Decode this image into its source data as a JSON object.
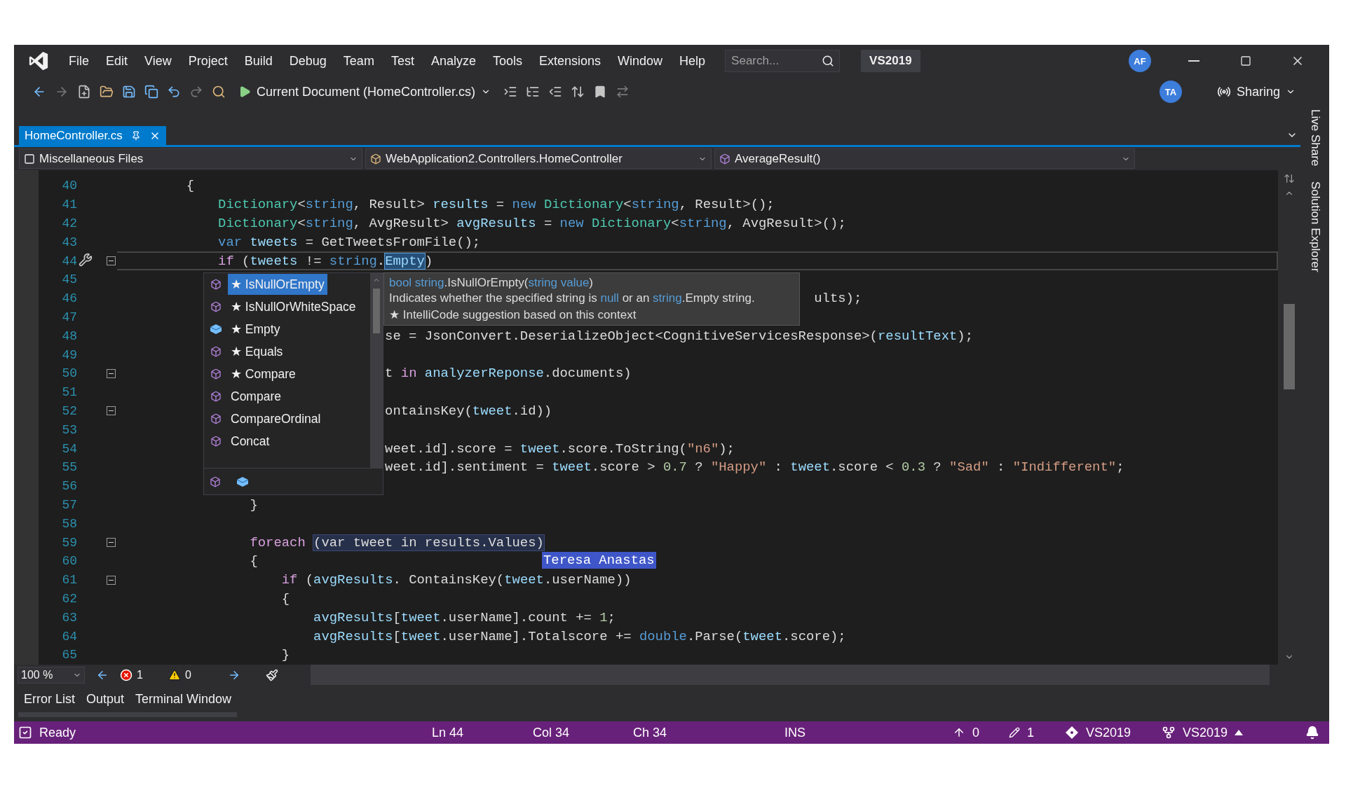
{
  "menu_bar": {
    "items": [
      "File",
      "Edit",
      "View",
      "Project",
      "Build",
      "Debug",
      "Team",
      "Test",
      "Analyze",
      "Tools",
      "Extensions",
      "Window",
      "Help"
    ],
    "search": {
      "placeholder": "Search..."
    },
    "solution_badge": "VS2019",
    "account_avatar": "AF"
  },
  "toolbar": {
    "run_target": "Current Document (HomeController.cs)",
    "collaborator_avatar": "TA",
    "share_button": "Sharing"
  },
  "document_tabs": [
    {
      "label": "HomeController.cs",
      "selected": true
    }
  ],
  "navigation_bar": {
    "project": "Miscellaneous Files",
    "type": "WebApplication2.Controllers.HomeController",
    "member": "AverageResult()"
  },
  "editor": {
    "lines": [
      {
        "number": "40",
        "current": false,
        "foldable": false,
        "tokens": [
          {
            "kind": "p",
            "text": "        {"
          }
        ]
      },
      {
        "number": "41",
        "current": false,
        "foldable": false,
        "tokens": [
          {
            "kind": "t",
            "text": "            Dictionary"
          },
          {
            "kind": "p",
            "text": "<"
          },
          {
            "kind": "k",
            "text": "string"
          },
          {
            "kind": "p",
            "text": ", Result> "
          },
          {
            "kind": "v",
            "text": "results"
          },
          {
            "kind": "p",
            "text": " = "
          },
          {
            "kind": "k",
            "text": "new "
          },
          {
            "kind": "t",
            "text": "Dictionary"
          },
          {
            "kind": "p",
            "text": "<"
          },
          {
            "kind": "k",
            "text": "string"
          },
          {
            "kind": "p",
            "text": ", Result>();"
          }
        ]
      },
      {
        "number": "42",
        "current": false,
        "foldable": false,
        "tokens": [
          {
            "kind": "t",
            "text": "            Dictionary"
          },
          {
            "kind": "p",
            "text": "<"
          },
          {
            "kind": "k",
            "text": "string"
          },
          {
            "kind": "p",
            "text": ", AvgResult> "
          },
          {
            "kind": "v",
            "text": "avgResults"
          },
          {
            "kind": "p",
            "text": " = "
          },
          {
            "kind": "k",
            "text": "new "
          },
          {
            "kind": "t",
            "text": "Dictionary"
          },
          {
            "kind": "p",
            "text": "<"
          },
          {
            "kind": "k",
            "text": "string"
          },
          {
            "kind": "p",
            "text": ", AvgResult>();"
          }
        ]
      },
      {
        "number": "43",
        "current": false,
        "foldable": false,
        "tokens": [
          {
            "kind": "k",
            "text": "            var "
          },
          {
            "kind": "v",
            "text": "tweets"
          },
          {
            "kind": "p",
            "text": " = GetTweetsFromFile();"
          }
        ]
      },
      {
        "number": "44",
        "current": true,
        "foldable": true,
        "tokens": [
          {
            "kind": "c",
            "text": "            if"
          },
          {
            "kind": "p",
            "text": " ("
          },
          {
            "kind": "v",
            "text": "tweets"
          },
          {
            "kind": "p",
            "text": " != "
          },
          {
            "kind": "k",
            "text": "string"
          },
          {
            "kind": "p",
            "text": "."
          },
          {
            "kind": "h",
            "text": "Empty"
          },
          {
            "kind": "p",
            "text": ")"
          }
        ]
      },
      {
        "number": "45",
        "current": false,
        "foldable": false
      },
      {
        "number": "46",
        "current": false,
        "foldable": false,
        "tokens": [
          {
            "kind": "p",
            "text": "                                                                                       ults);"
          }
        ]
      },
      {
        "number": "47",
        "current": false,
        "foldable": false
      },
      {
        "number": "48",
        "current": false,
        "foldable": false,
        "tokens": [
          {
            "kind": "p",
            "text": "                                 se = JsonConvert.DeserializeObject<CognitiveServicesResponse>("
          },
          {
            "kind": "v",
            "text": "resultText"
          },
          {
            "kind": "p",
            "text": ");"
          }
        ]
      },
      {
        "number": "49",
        "current": false,
        "foldable": false
      },
      {
        "number": "50",
        "current": false,
        "foldable": true,
        "tokens": [
          {
            "kind": "p",
            "text": "                                 t "
          },
          {
            "kind": "c",
            "text": "in "
          },
          {
            "kind": "v",
            "text": "analyzerReponse"
          },
          {
            "kind": "p",
            "text": ".documents)"
          }
        ]
      },
      {
        "number": "51",
        "current": false,
        "foldable": false
      },
      {
        "number": "52",
        "current": false,
        "foldable": true,
        "tokens": [
          {
            "kind": "p",
            "text": "                                 ontainsKey("
          },
          {
            "kind": "v",
            "text": "tweet"
          },
          {
            "kind": "p",
            "text": ".id))"
          }
        ]
      },
      {
        "number": "53",
        "current": false,
        "foldable": false
      },
      {
        "number": "54",
        "current": false,
        "foldable": false,
        "tokens": [
          {
            "kind": "p",
            "text": "                                 weet.id].score = "
          },
          {
            "kind": "v",
            "text": "tweet"
          },
          {
            "kind": "p",
            "text": ".score.ToString("
          },
          {
            "kind": "s",
            "text": "\"n6\""
          },
          {
            "kind": "p",
            "text": ");"
          }
        ]
      },
      {
        "number": "55",
        "current": false,
        "foldable": false,
        "tokens": [
          {
            "kind": "p",
            "text": "                                 weet.id].sentiment = "
          },
          {
            "kind": "v",
            "text": "tweet"
          },
          {
            "kind": "p",
            "text": ".score > "
          },
          {
            "kind": "n",
            "text": "0.7"
          },
          {
            "kind": "p",
            "text": " ? "
          },
          {
            "kind": "s",
            "text": "\"Happy\""
          },
          {
            "kind": "p",
            "text": " : "
          },
          {
            "kind": "v",
            "text": "tweet"
          },
          {
            "kind": "p",
            "text": ".score < "
          },
          {
            "kind": "n",
            "text": "0.3"
          },
          {
            "kind": "p",
            "text": " ? "
          },
          {
            "kind": "s",
            "text": "\"Sad\""
          },
          {
            "kind": "p",
            "text": " : "
          },
          {
            "kind": "s",
            "text": "\"Indifferent\""
          },
          {
            "kind": "p",
            "text": ";"
          }
        ]
      },
      {
        "number": "56",
        "current": false,
        "foldable": false
      },
      {
        "number": "57",
        "current": false,
        "foldable": false,
        "tokens": [
          {
            "kind": "p",
            "text": "                }"
          }
        ]
      },
      {
        "number": "58",
        "current": false,
        "foldable": false
      },
      {
        "number": "59",
        "current": false,
        "foldable": true,
        "tokens": [
          {
            "kind": "c",
            "text": "                foreach "
          },
          {
            "kind": "x",
            "text": "(var tweet in results.Values)"
          }
        ]
      },
      {
        "number": "60",
        "current": false,
        "foldable": false,
        "tokens": [
          {
            "kind": "p",
            "text": "                {"
          }
        ]
      },
      {
        "number": "61",
        "current": false,
        "foldable": true,
        "tokens": [
          {
            "kind": "c",
            "text": "                    if"
          },
          {
            "kind": "p",
            "text": " ("
          },
          {
            "kind": "v",
            "text": "avgResults"
          },
          {
            "kind": "p",
            "text": ". ContainsKey("
          },
          {
            "kind": "v",
            "text": "tweet"
          },
          {
            "kind": "p",
            "text": ".userName))"
          }
        ]
      },
      {
        "number": "62",
        "current": false,
        "foldable": false,
        "tokens": [
          {
            "kind": "p",
            "text": "                    {"
          }
        ]
      },
      {
        "number": "63",
        "current": false,
        "foldable": false,
        "tokens": [
          {
            "kind": "v",
            "text": "                        avgResults"
          },
          {
            "kind": "p",
            "text": "["
          },
          {
            "kind": "v",
            "text": "tweet"
          },
          {
            "kind": "p",
            "text": ".userName].count += "
          },
          {
            "kind": "n",
            "text": "1"
          },
          {
            "kind": "p",
            "text": ";"
          }
        ]
      },
      {
        "number": "64",
        "current": false,
        "foldable": false,
        "tokens": [
          {
            "kind": "v",
            "text": "                        avgResults"
          },
          {
            "kind": "p",
            "text": "["
          },
          {
            "kind": "v",
            "text": "tweet"
          },
          {
            "kind": "p",
            "text": ".userName].Totalscore += "
          },
          {
            "kind": "k",
            "text": "double"
          },
          {
            "kind": "p",
            "text": ".Parse("
          },
          {
            "kind": "v",
            "text": "tweet"
          },
          {
            "kind": "p",
            "text": ".score);"
          }
        ]
      },
      {
        "number": "65",
        "current": false,
        "foldable": false,
        "tokens": [
          {
            "kind": "p",
            "text": "                    }"
          }
        ]
      }
    ],
    "completion_list": {
      "items": [
        {
          "label": "★ IsNullOrEmpty",
          "kind": "method",
          "selected": true
        },
        {
          "label": "★ IsNullOrWhiteSpace",
          "kind": "method",
          "selected": false
        },
        {
          "label": "★ Empty",
          "kind": "field",
          "selected": false
        },
        {
          "label": "★ Equals",
          "kind": "method",
          "selected": false
        },
        {
          "label": "★ Compare",
          "kind": "method",
          "selected": false
        },
        {
          "label": "Compare",
          "kind": "method",
          "selected": false
        },
        {
          "label": "CompareOrdinal",
          "kind": "method",
          "selected": false
        },
        {
          "label": "Concat",
          "kind": "method",
          "selected": false
        }
      ]
    },
    "quick_info": {
      "signature": [
        {
          "kind": "k",
          "text": "bool string"
        },
        {
          "kind": "p",
          "text": ".IsNullOrEmpty("
        },
        {
          "kind": "k",
          "text": "string value"
        },
        {
          "kind": "p",
          "text": ")"
        }
      ],
      "description": [
        {
          "kind": "p",
          "text": "Indicates whether the specified string is "
        },
        {
          "kind": "k",
          "text": "null"
        },
        {
          "kind": "p",
          "text": " or an "
        },
        {
          "kind": "k",
          "text": "string"
        },
        {
          "kind": "p",
          "text": ".Empty string."
        }
      ],
      "note": "★  IntelliCode suggestion based on this context"
    },
    "collaborator_flag": "Teresa Anastas"
  },
  "zoom_bar": {
    "zoom": "100 %",
    "errors": "1",
    "warnings": "0"
  },
  "tool_window_tabs": [
    "Error List",
    "Output",
    "Terminal Window"
  ],
  "side_tabs": [
    "Live Share",
    "Solution Explorer"
  ],
  "status_bar": {
    "state": "Ready",
    "line": "Ln 44",
    "column": "Col 34",
    "character": "Ch 34",
    "mode": "INS",
    "outgoing": "0",
    "pending_edits": "1",
    "repository": "VS2019",
    "branch": "VS2019"
  }
}
